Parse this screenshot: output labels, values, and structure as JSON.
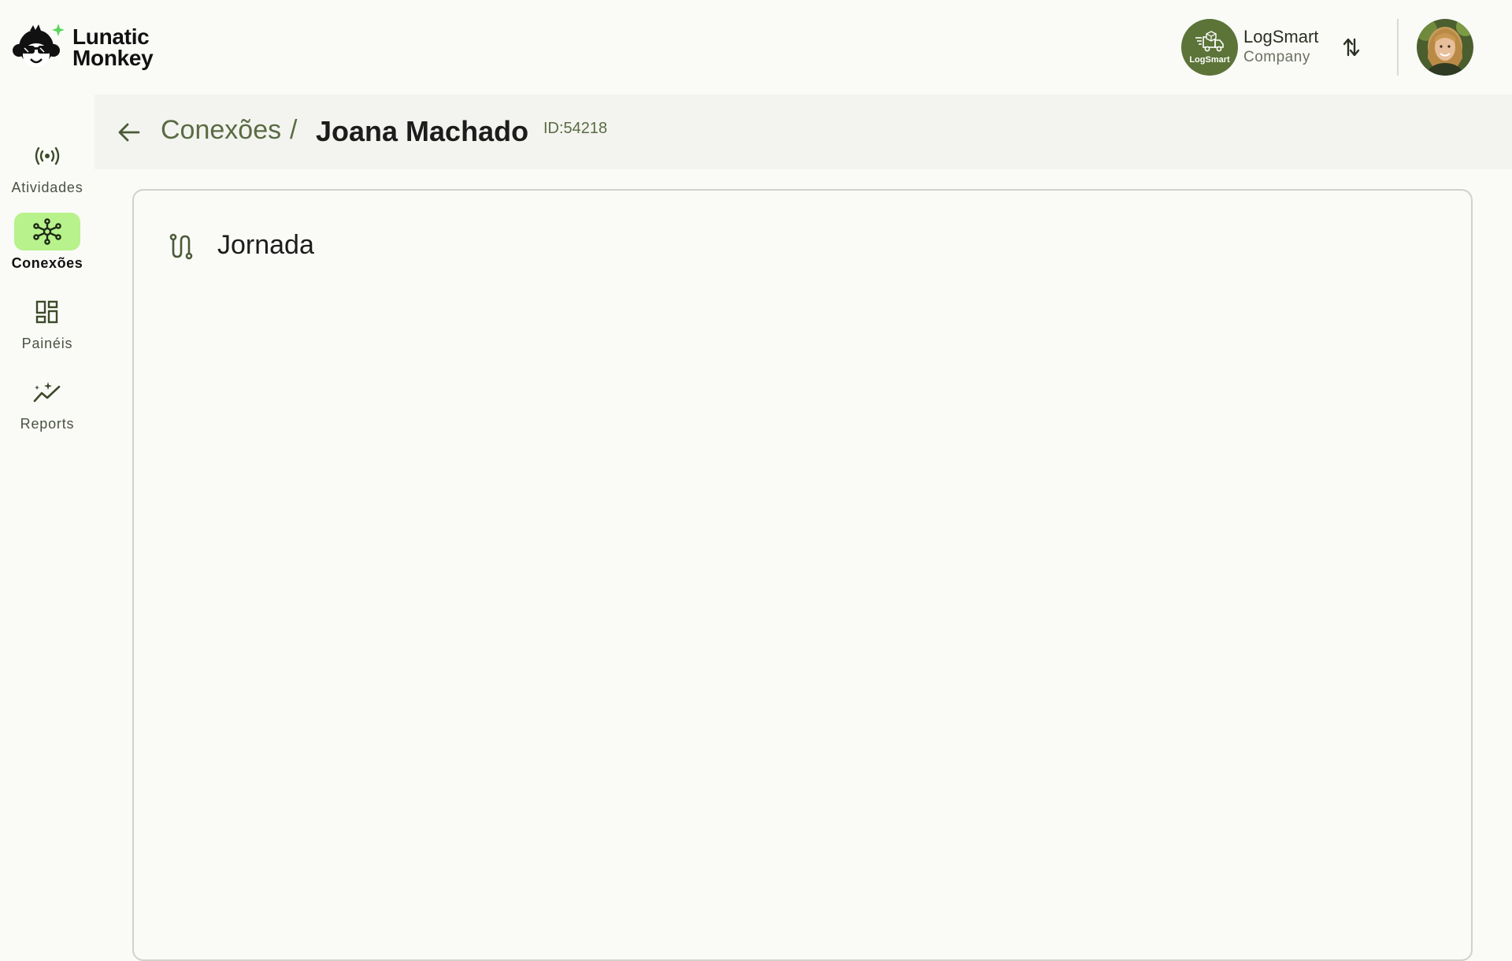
{
  "app": {
    "logo_line1": "Lunatic",
    "logo_line2": "Monkey"
  },
  "company": {
    "logo_text": "LogSmart",
    "name": "LogSmart",
    "type": "Company"
  },
  "sidebar": {
    "items": [
      {
        "label": "Atividades",
        "icon": "activity-broadcast-icon",
        "active": false
      },
      {
        "label": "Conexões",
        "icon": "connections-network-icon",
        "active": true
      },
      {
        "label": "Painéis",
        "icon": "dashboard-icon",
        "active": false
      },
      {
        "label": "Reports",
        "icon": "reports-chart-icon",
        "active": false
      }
    ]
  },
  "header": {
    "breadcrumb_parent": "Conexões",
    "breadcrumb_separator": "/",
    "current": "Joana Machado",
    "record_id": "ID:54218"
  },
  "card": {
    "title": "Jornada",
    "icon": "route-icon"
  },
  "colors": {
    "accent_active": "#b7f28c",
    "brand_green": "#5c7438",
    "breadcrumb_green": "#5a6b44"
  }
}
